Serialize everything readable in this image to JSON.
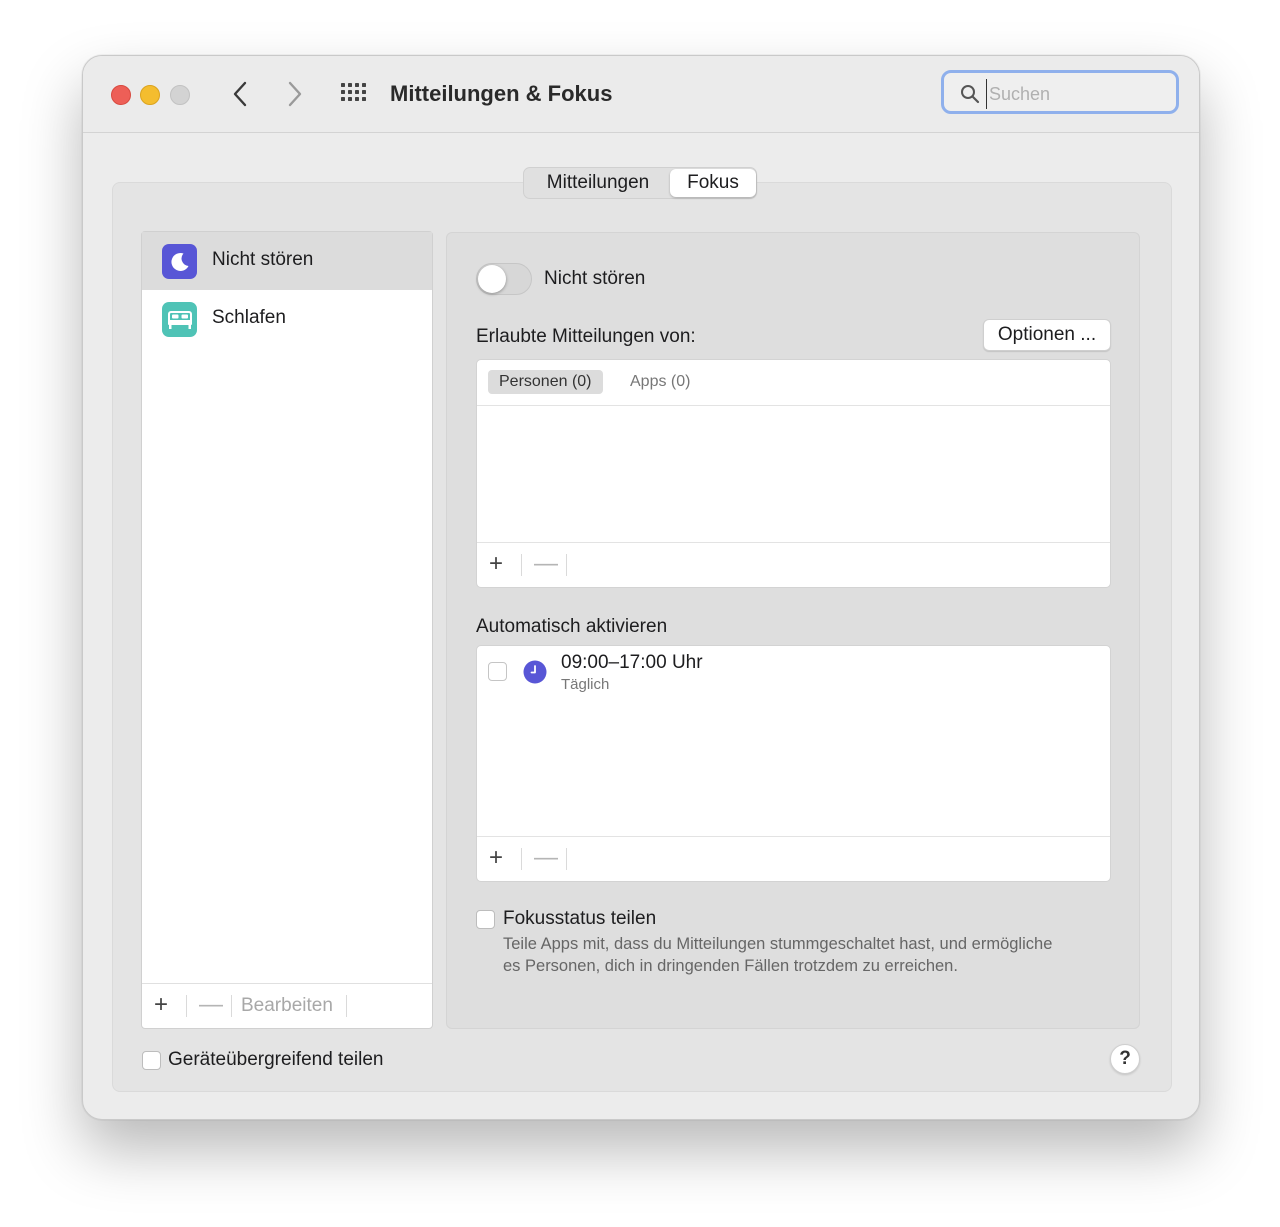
{
  "window": {
    "title": "Mitteilungen & Fokus",
    "search": {
      "value": "",
      "placeholder": "Suchen"
    }
  },
  "tabs": [
    {
      "label": "Mitteilungen",
      "selected": false
    },
    {
      "label": "Fokus",
      "selected": true
    }
  ],
  "focus_list": {
    "items": [
      {
        "label": "Nicht stören",
        "icon": "moon-icon",
        "color": "#5856d6",
        "selected": true
      },
      {
        "label": "Schlafen",
        "icon": "bed-icon",
        "color": "#4fc3b6",
        "selected": false
      }
    ],
    "add_label": "+",
    "remove_label": "—",
    "edit_label": "Bearbeiten"
  },
  "detail": {
    "toggle": {
      "label": "Nicht stören",
      "on": false
    },
    "allowed": {
      "label": "Erlaubte Mitteilungen von:",
      "options_button": "Optionen ...",
      "tabs": [
        {
          "label": "Personen (0)",
          "selected": true
        },
        {
          "label": "Apps (0)",
          "selected": false
        }
      ],
      "add_label": "+",
      "remove_label": "—"
    },
    "auto": {
      "label": "Automatisch aktivieren",
      "schedules": [
        {
          "time": "09:00–17:00 Uhr",
          "repeat": "Täglich",
          "enabled": false,
          "icon": "clock-icon"
        }
      ],
      "add_label": "+",
      "remove_label": "—"
    },
    "share_status": {
      "label": "Fokusstatus teilen",
      "description": "Teile Apps mit, dass du Mitteilungen stummgeschaltet hast, und ermögliche es Personen, dich in dringenden Fällen trotzdem zu erreichen.",
      "checked": false
    }
  },
  "footer": {
    "share_across_devices": {
      "label": "Geräteübergreifend teilen",
      "checked": false
    },
    "help_label": "?"
  },
  "colors": {
    "accent": "#5856d6",
    "sleep": "#4fc3b6",
    "close": "#ed5f57",
    "minimize": "#f4bd2f",
    "search_focus_ring": "#8fb0ec"
  }
}
